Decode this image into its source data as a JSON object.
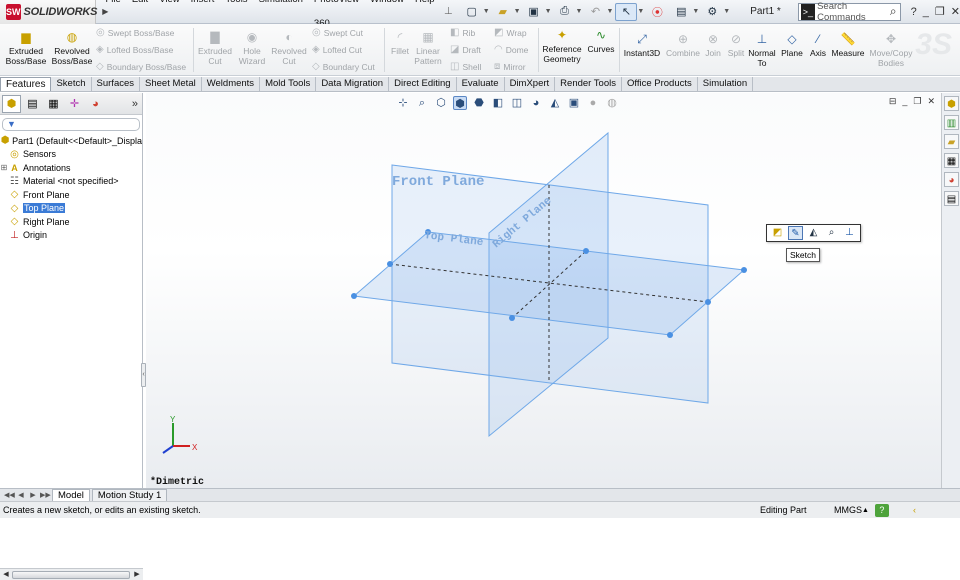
{
  "app": {
    "brand_mark": "SW",
    "brand": "SOLIDWORKS",
    "doc_title": "Part1 *"
  },
  "menu": [
    "File",
    "Edit",
    "View",
    "Insert",
    "Tools",
    "Simulation",
    "PhotoView 360",
    "Window",
    "Help"
  ],
  "search": {
    "placeholder": "Search Commands"
  },
  "ribbon": {
    "extruded_boss": "Extruded Boss/Base",
    "revolved_boss": "Revolved Boss/Base",
    "swept_boss": "Swept Boss/Base",
    "lofted_boss": "Lofted Boss/Base",
    "boundary_boss": "Boundary Boss/Base",
    "extruded_cut": "Extruded Cut",
    "hole_wizard": "Hole Wizard",
    "revolved_cut": "Revolved Cut",
    "swept_cut": "Swept Cut",
    "lofted_cut": "Lofted Cut",
    "boundary_cut": "Boundary Cut",
    "fillet": "Fillet",
    "linear_pattern": "Linear Pattern",
    "rib": "Rib",
    "draft": "Draft",
    "shell": "Shell",
    "wrap": "Wrap",
    "dome": "Dome",
    "mirror": "Mirror",
    "reference_geometry": "Reference Geometry",
    "curves": "Curves",
    "instant3d": "Instant3D",
    "combine": "Combine",
    "join": "Join",
    "split": "Split",
    "normal_to": "Normal To",
    "plane": "Plane",
    "axis": "Axis",
    "measure": "Measure",
    "move_copy": "Move/Copy Bodies"
  },
  "tabs": [
    "Features",
    "Sketch",
    "Surfaces",
    "Sheet Metal",
    "Weldments",
    "Mold Tools",
    "Data Migration",
    "Direct Editing",
    "Evaluate",
    "DimXpert",
    "Render Tools",
    "Office Products",
    "Simulation"
  ],
  "tree": {
    "root": "Part1  (Default<<Default>_Displa",
    "items": [
      {
        "label": "Sensors",
        "icon": "sensor-icon",
        "expand": false,
        "selected": false
      },
      {
        "label": "Annotations",
        "icon": "annotation-icon",
        "expand": true,
        "selected": false
      },
      {
        "label": "Material <not specified>",
        "icon": "material-icon",
        "expand": false,
        "selected": false
      },
      {
        "label": "Front Plane",
        "icon": "plane-icon",
        "expand": false,
        "selected": false
      },
      {
        "label": "Top Plane",
        "icon": "plane-icon",
        "expand": false,
        "selected": true
      },
      {
        "label": "Right Plane",
        "icon": "plane-icon",
        "expand": false,
        "selected": false
      },
      {
        "label": "Origin",
        "icon": "origin-icon",
        "expand": false,
        "selected": false
      }
    ]
  },
  "graphics": {
    "view_name": "*Dimetric",
    "front_plane_label": "Front Plane",
    "top_plane_label": "Top Plane",
    "right_plane_label": "Right Plane",
    "tooltip": "Sketch",
    "triad": {
      "x": "X",
      "y": "Y"
    },
    "plane_color": "#6fa8e8"
  },
  "bottom_tabs": [
    "Model",
    "Motion Study 1"
  ],
  "status": {
    "message": "Creates a new sketch, or edits an existing sketch.",
    "mode": "Editing Part",
    "units": "MMGS"
  }
}
